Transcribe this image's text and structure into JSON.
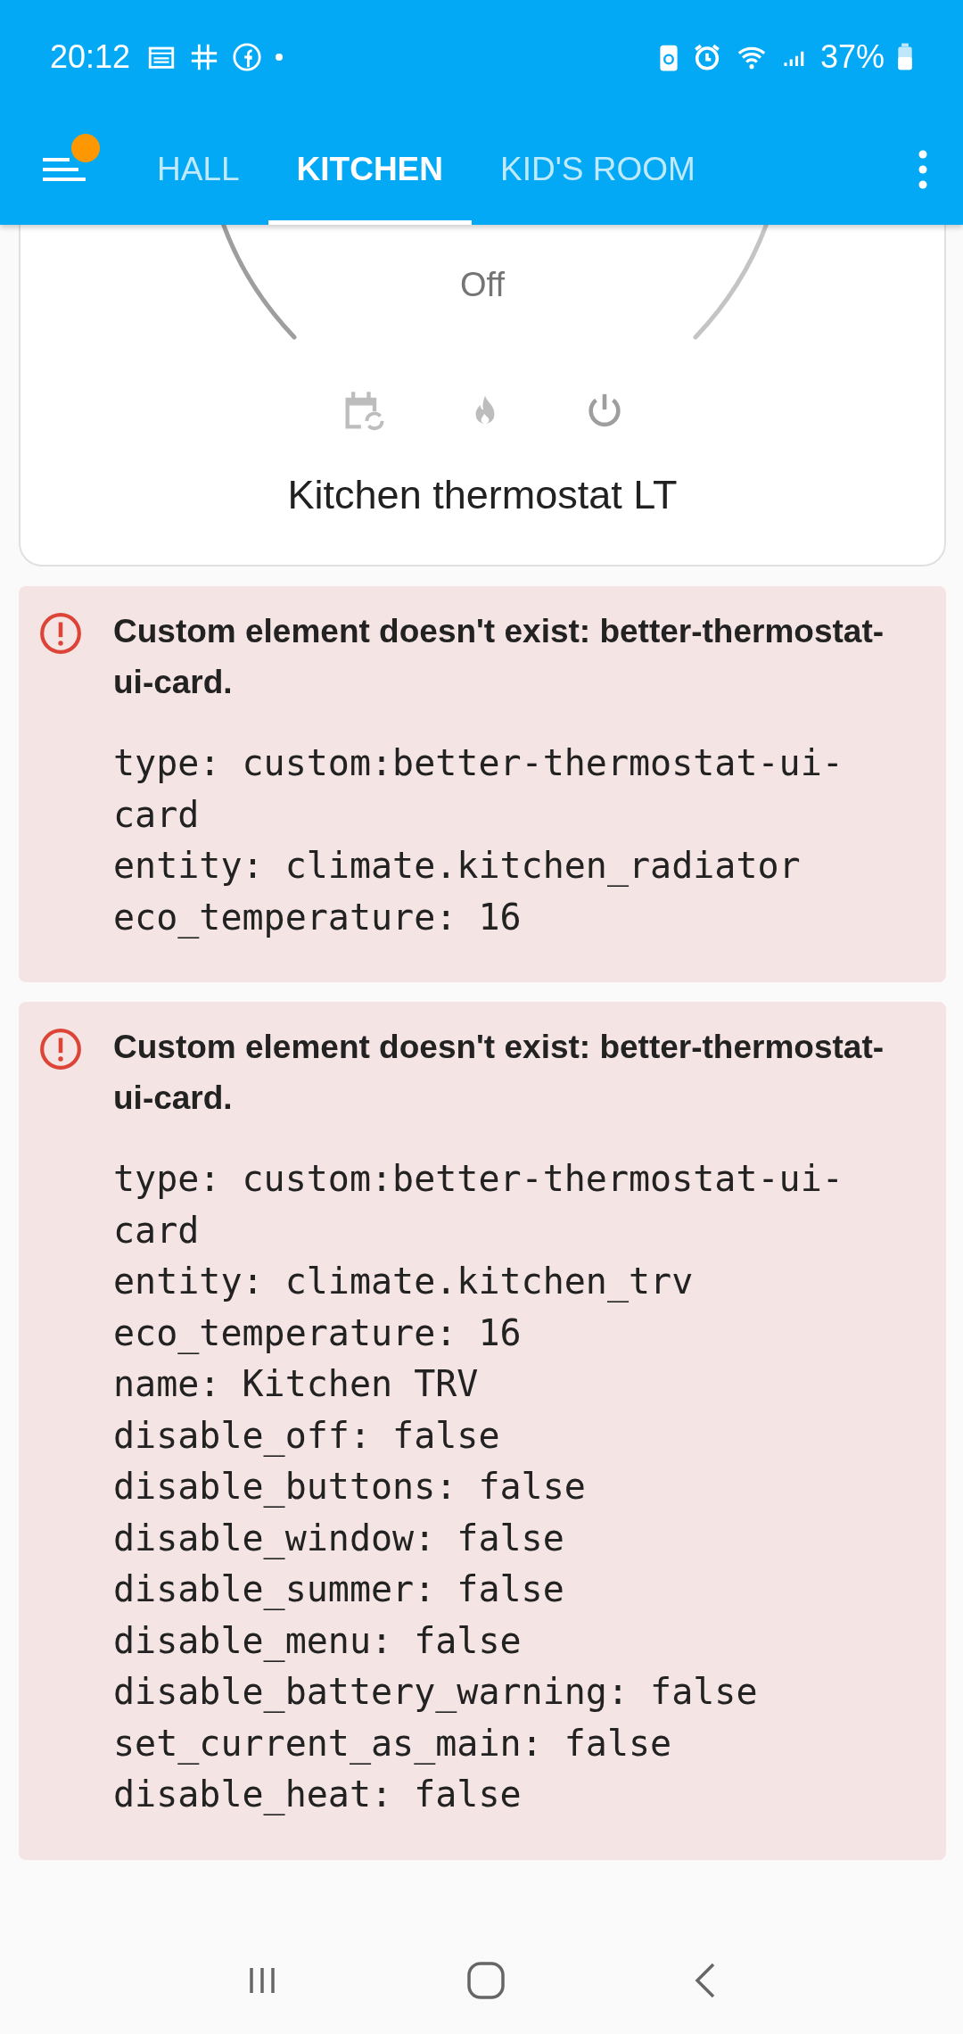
{
  "status_bar": {
    "time": "20:12",
    "battery": "37%"
  },
  "header": {
    "tabs": [
      {
        "label": "HALL",
        "selected": false
      },
      {
        "label": "KITCHEN",
        "selected": true
      },
      {
        "label": "KID'S ROOM",
        "selected": false
      }
    ],
    "notification_badge": true
  },
  "thermostat_card": {
    "mode": "Off",
    "name": "Kitchen thermostat LT"
  },
  "error_cards": [
    {
      "message": "Custom element doesn't exist: better-thermostat-ui-card.",
      "config": [
        "type: custom:better-thermostat-ui-card",
        "entity: climate.kitchen_radiator",
        "eco_temperature: 16"
      ]
    },
    {
      "message": "Custom element doesn't exist: better-thermostat-ui-card.",
      "config": [
        "type: custom:better-thermostat-ui-card",
        "entity: climate.kitchen_trv",
        "eco_temperature: 16",
        "name: Kitchen TRV",
        "disable_off: false",
        "disable_buttons: false",
        "disable_window: false",
        "disable_summer: false",
        "disable_menu: false",
        "disable_battery_warning: false",
        "set_current_as_main: false",
        "disable_heat: false"
      ]
    }
  ]
}
